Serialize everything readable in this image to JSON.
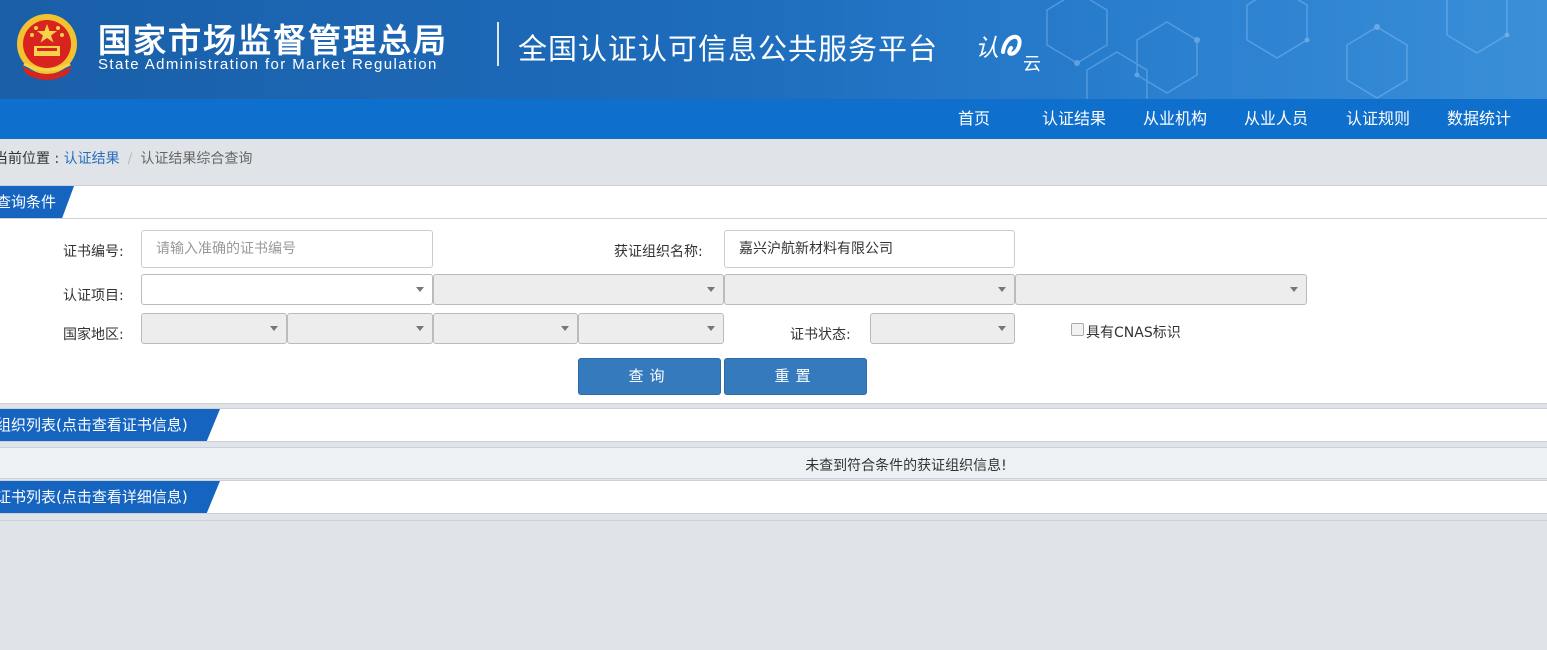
{
  "header": {
    "agency_cn": "国家市场监督管理总局",
    "agency_en": "State Administration  for  Market Regulation",
    "platform": "全国认证认可信息公共服务平台",
    "platform_logo_text": "认云"
  },
  "nav": {
    "items": [
      {
        "label": "首页"
      },
      {
        "label": "认证结果"
      },
      {
        "label": "从业机构"
      },
      {
        "label": "从业人员"
      },
      {
        "label": "认证规则"
      },
      {
        "label": "数据统计"
      }
    ]
  },
  "breadcrumb": {
    "prefix": "当前位置 : ",
    "link": "认证结果",
    "separator": "/",
    "current": "认证结果综合查询"
  },
  "query": {
    "section_title": "查询条件",
    "cert_no_label": "证书编号:",
    "cert_no_placeholder": "请输入准确的证书编号",
    "org_name_label": "获证组织名称:",
    "org_name_value": "嘉兴沪航新材料有限公司",
    "cert_project_label": "认证项目:",
    "region_label": "国家地区:",
    "cert_status_label": "证书状态:",
    "cnas_label": "具有CNAS标识",
    "search_button": "查询",
    "reset_button": "重置"
  },
  "org_list": {
    "section_title": "组织列表(点击查看证书信息)",
    "empty_message": "未查到符合条件的获证组织信息!"
  },
  "cert_list": {
    "section_title": "证书列表(点击查看详细信息)"
  },
  "colors": {
    "banner": "#1d6bbb",
    "nav": "#0f6fcc",
    "section_tab": "#1565c0",
    "button": "#347abd",
    "link": "#2a6ebb"
  }
}
